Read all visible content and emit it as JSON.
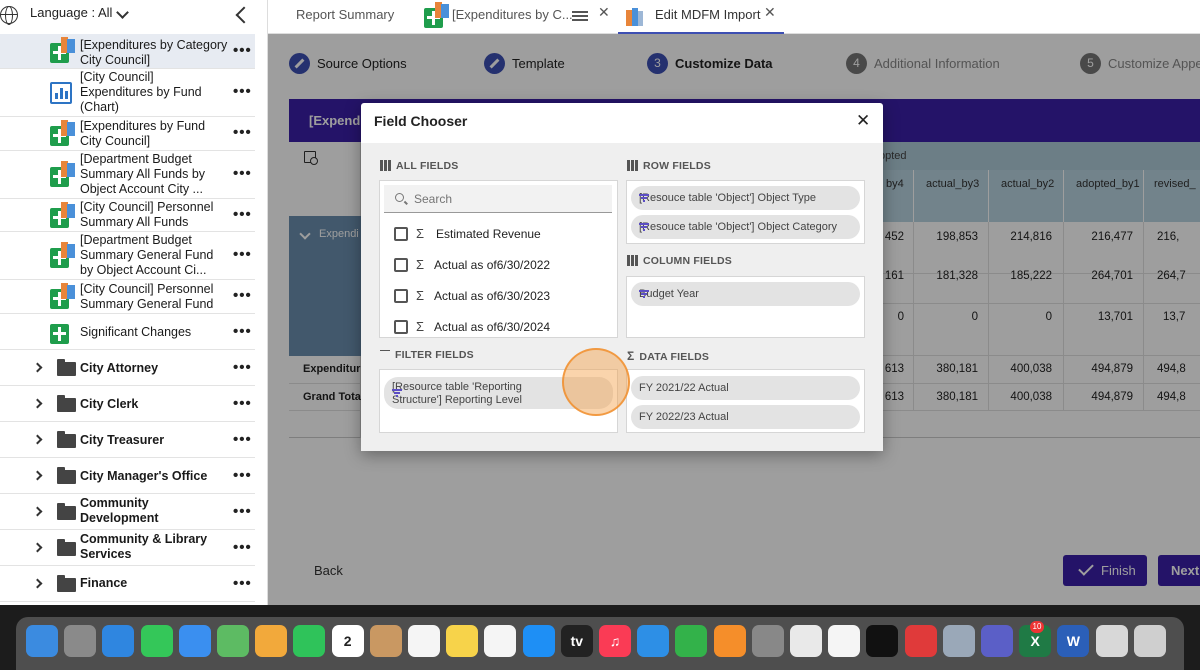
{
  "sidebar": {
    "language_label": "Language : All",
    "items": [
      {
        "label": "[Expenditures by Category City Council]",
        "icon": "report-grid-icon"
      },
      {
        "label": "[City Council] Expenditures by Fund (Chart)",
        "icon": "bar-chart-icon"
      },
      {
        "label": "[Expenditures by Fund City Council]",
        "icon": "report-grid-icon"
      },
      {
        "label": "[Department Budget Summary All Funds by Object Account City ...",
        "icon": "report-grid-icon"
      },
      {
        "label": "[City Council] Personnel Summary All Funds",
        "icon": "report-grid-icon"
      },
      {
        "label": "[Department Budget Summary General Fund by Object Account Ci...",
        "icon": "report-grid-icon"
      },
      {
        "label": "[City Council] Personnel Summary General Fund",
        "icon": "report-grid-icon"
      },
      {
        "label": "Significant Changes",
        "icon": "plus-sheet-icon"
      }
    ],
    "folders": [
      "City Attorney",
      "City Clerk",
      "City Treasurer",
      "City Manager's Office",
      "Community Development",
      "Community & Library Services",
      "Finance"
    ],
    "more_glyph": "•••"
  },
  "tabs": [
    {
      "label": "Report Summary"
    },
    {
      "label": "[Expenditures by C..."
    },
    {
      "label": "Edit MDFM Import"
    }
  ],
  "close_glyph": "✕",
  "stepper": [
    {
      "num": "",
      "label": "Source Options",
      "state": "done"
    },
    {
      "num": "",
      "label": "Template",
      "state": "done"
    },
    {
      "num": "3",
      "label": "Customize Data",
      "state": "current"
    },
    {
      "num": "4",
      "label": "Additional Information",
      "state": "future"
    },
    {
      "num": "5",
      "label": "Customize Appe",
      "state": "future"
    }
  ],
  "banner_title": "[Expendi",
  "grid": {
    "header_group": "opted",
    "columns": [
      "by4",
      "actual_by3",
      "actual_by2",
      "adopted_by1",
      "revised_"
    ],
    "expand_label": "Expendi",
    "rows": [
      [
        "452",
        "198,853",
        "214,816",
        "216,477",
        "216,"
      ],
      [
        "161",
        "181,328",
        "185,222",
        "264,701",
        "264,7"
      ],
      [
        "0",
        "0",
        "0",
        "13,701",
        "13,7"
      ],
      [
        "613",
        "380,181",
        "400,038",
        "494,879",
        "494,8"
      ],
      [
        "613",
        "380,181",
        "400,038",
        "494,879",
        "494,8"
      ]
    ],
    "row_labels": [
      "Expenditure",
      "Grand Total"
    ]
  },
  "buttons": {
    "back": "Back",
    "finish": "Finish",
    "next": "Next"
  },
  "dialog": {
    "title": "Field Chooser",
    "close": "✕",
    "all_fields": "ALL FIELDS",
    "search_placeholder": "Search",
    "fields": [
      "Estimated Revenue",
      "Actual as of6/30/2022",
      "Actual as of6/30/2023",
      "Actual as of6/30/2024"
    ],
    "sigma": "Σ",
    "row_fields_title": "ROW FIELDS",
    "row_fields": [
      "[Resouce table 'Object'] Object Type",
      "[Resouce table 'Object'] Object Category"
    ],
    "column_fields_title": "COLUMN FIELDS",
    "column_fields": [
      "Budget Year"
    ],
    "filter_fields_title": "FILTER FIELDS",
    "filter_fields": [
      "[Resource table 'Reporting Structure'] Reporting Level"
    ],
    "data_fields_title": "DATA FIELDS",
    "data_fields": [
      "FY 2021/22 Actual",
      "FY 2022/23 Actual"
    ]
  },
  "dock": {
    "apps": [
      {
        "icon": "finder-icon",
        "color": "#3b8be0",
        "glyph": ""
      },
      {
        "icon": "launchpad-icon",
        "color": "#8a8a8a",
        "glyph": ""
      },
      {
        "icon": "safari-icon",
        "color": "#2f86e0",
        "glyph": ""
      },
      {
        "icon": "messages-icon",
        "color": "#34c759",
        "glyph": ""
      },
      {
        "icon": "mail-icon",
        "color": "#3a8ff0",
        "glyph": ""
      },
      {
        "icon": "maps-icon",
        "color": "#5dbb63",
        "glyph": ""
      },
      {
        "icon": "photos-icon",
        "color": "#f2a93b",
        "glyph": ""
      },
      {
        "icon": "facetime-icon",
        "color": "#2fc35a",
        "glyph": ""
      },
      {
        "icon": "calendar-icon",
        "color": "#ffffff",
        "glyph": "2"
      },
      {
        "icon": "contacts-icon",
        "color": "#c99862",
        "glyph": ""
      },
      {
        "icon": "reminders-icon",
        "color": "#f5f5f5",
        "glyph": ""
      },
      {
        "icon": "notes-icon",
        "color": "#f7d34a",
        "glyph": ""
      },
      {
        "icon": "freeform-icon",
        "color": "#f5f5f5",
        "glyph": ""
      },
      {
        "icon": "app-store-icon",
        "color": "#1e8ff5",
        "glyph": ""
      },
      {
        "icon": "tv-icon",
        "color": "#222222",
        "glyph": "tv"
      },
      {
        "icon": "music-icon",
        "color": "#fa3b55",
        "glyph": "♫"
      },
      {
        "icon": "keynote-icon",
        "color": "#2d8fe6",
        "glyph": ""
      },
      {
        "icon": "numbers-icon",
        "color": "#33b24a",
        "glyph": ""
      },
      {
        "icon": "pages-icon",
        "color": "#f58e2a",
        "glyph": ""
      },
      {
        "icon": "settings-icon",
        "color": "#888888",
        "glyph": ""
      },
      {
        "icon": "chrome-icon",
        "color": "#e9e9e9",
        "glyph": ""
      },
      {
        "icon": "slack-icon",
        "color": "#f5f5f5",
        "glyph": ""
      },
      {
        "icon": "keeper-icon",
        "color": "#111111",
        "glyph": ""
      },
      {
        "icon": "scrivener-icon",
        "color": "#e03a3a",
        "glyph": ""
      },
      {
        "icon": "preview-icon",
        "color": "#9aa8b8",
        "glyph": ""
      },
      {
        "icon": "teams-icon",
        "color": "#5b5fc7",
        "glyph": ""
      },
      {
        "icon": "excel-icon",
        "color": "#1f7a45",
        "glyph": "X"
      },
      {
        "icon": "word-icon",
        "color": "#2b5fb8",
        "glyph": "W"
      },
      {
        "icon": "documents-icon",
        "color": "#d8d8d8",
        "glyph": ""
      },
      {
        "icon": "trash-icon",
        "color": "#cfcfcf",
        "glyph": ""
      }
    ],
    "badge": "10"
  }
}
